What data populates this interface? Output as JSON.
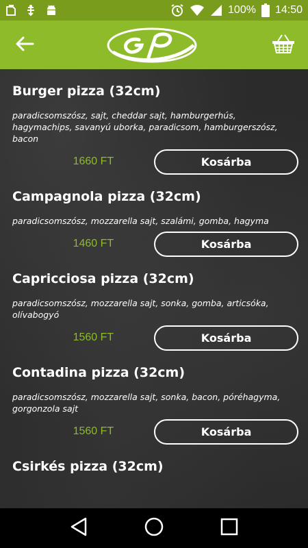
{
  "status_bar": {
    "battery": "100%",
    "time": "14:50",
    "icons": [
      "notification-icon",
      "android-debug-icon",
      "alarm-icon",
      "wifi-icon",
      "signal-icon",
      "battery-icon"
    ]
  },
  "header": {
    "back_icon": "back-arrow-icon",
    "logo_icon": "gp-logo",
    "cart_icon": "basket-icon"
  },
  "menu": {
    "items": [
      {
        "title": "Burger pizza (32cm)",
        "description": "paradicsomszósz, sajt, cheddar sajt, hamburgerhús, hagymachips, savanyú uborka, paradicsom, hamburgerszósz, bacon",
        "price": "1660 FT",
        "button": "Kosárba"
      },
      {
        "title": "Campagnola pizza (32cm)",
        "description": "paradicsomszósz, mozzarella sajt, szalámi, gomba, hagyma",
        "price": "1460 FT",
        "button": "Kosárba"
      },
      {
        "title": "Capricciosa pizza (32cm)",
        "description": "paradicsomszósz, mozzarella sajt, sonka, gomba, articsóka, olívabogyó",
        "price": "1560 FT",
        "button": "Kosárba"
      },
      {
        "title": "Contadina pizza (32cm)",
        "description": "paradicsomszósz, mozzarella sajt, sonka, bacon, póréhagyma, gorgonzola sajt",
        "price": "1560 FT",
        "button": "Kosárba"
      },
      {
        "title": "Csirkés pizza (32cm)"
      }
    ]
  },
  "nav_bar": {
    "icons": [
      "back-triangle-icon",
      "home-circle-icon",
      "recents-square-icon"
    ]
  },
  "colors": {
    "accent": "#8dbb2a",
    "status_bar": "#7a9c1c",
    "background": "#2b2b2b"
  }
}
